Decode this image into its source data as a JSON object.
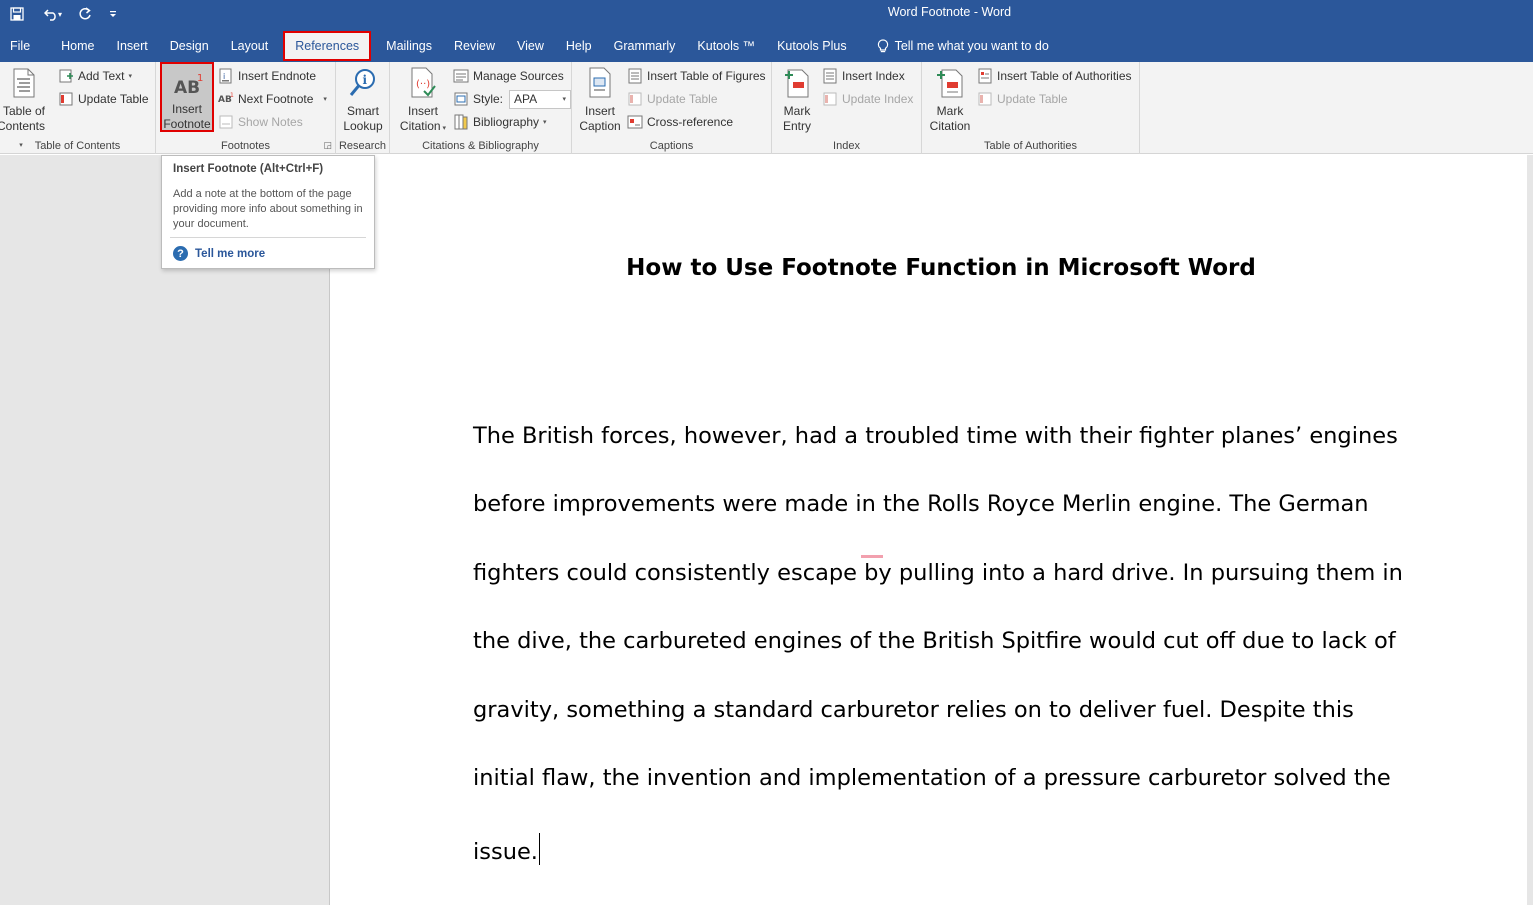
{
  "window": {
    "title": "Word Footnote  -  Word"
  },
  "qat": {
    "save_icon": "save-icon",
    "undo_icon": "undo-icon",
    "redo_icon": "redo-icon",
    "customize_icon": "customize-icon"
  },
  "tabs": [
    {
      "label": "File"
    },
    {
      "label": "Home"
    },
    {
      "label": "Insert"
    },
    {
      "label": "Design"
    },
    {
      "label": "Layout"
    },
    {
      "label": "References",
      "active": true
    },
    {
      "label": "Mailings"
    },
    {
      "label": "Review"
    },
    {
      "label": "View"
    },
    {
      "label": "Help"
    },
    {
      "label": "Grammarly"
    },
    {
      "label": "Kutools ™"
    },
    {
      "label": "Kutools Plus"
    }
  ],
  "tell_me": "Tell me what you want to do",
  "ribbon": {
    "toc": {
      "label": "Table of Contents",
      "big_line1": "Table of",
      "big_line2": "Contents",
      "add_text": "Add Text",
      "update_table": "Update Table"
    },
    "footnotes": {
      "label": "Footnotes",
      "insert_line1": "Insert",
      "insert_line2": "Footnote",
      "insert_endnote": "Insert Endnote",
      "next_footnote": "Next Footnote",
      "show_notes": "Show Notes"
    },
    "research": {
      "label": "Research",
      "line1": "Smart",
      "line2": "Lookup"
    },
    "citations": {
      "label": "Citations & Bibliography",
      "insert_line1": "Insert",
      "insert_line2": "Citation",
      "manage_sources": "Manage Sources",
      "style_label": "Style:",
      "style_value": "APA",
      "bibliography": "Bibliography"
    },
    "captions": {
      "label": "Captions",
      "insert_line1": "Insert",
      "insert_line2": "Caption",
      "insert_table_figures": "Insert Table of Figures",
      "update_table": "Update Table",
      "cross_reference": "Cross-reference"
    },
    "index": {
      "label": "Index",
      "mark_line1": "Mark",
      "mark_line2": "Entry",
      "insert_index": "Insert Index",
      "update_index": "Update Index"
    },
    "authorities": {
      "label": "Table of Authorities",
      "mark_line1": "Mark",
      "mark_line2": "Citation",
      "insert_table": "Insert Table of Authorities",
      "update_table": "Update Table"
    }
  },
  "tooltip": {
    "title": "Insert Footnote (Alt+Ctrl+F)",
    "description": "Add a note at the bottom of the page providing more info about something in your document.",
    "link": "Tell me more"
  },
  "document": {
    "title": "How to Use Footnote Function in Microsoft Word",
    "lines": [
      "The British forces, however, had a troubled time with their fighter planes’ engines",
      "before improvements were made in the Rolls Royce Merlin engine. The German",
      "fighters could consistently escape by pulling into a hard drive. In pursuing them in",
      "the dive, the carbureted engines of the British Spitfire would cut off due to lack of",
      "gravity, something a standard carburetor relies on to deliver fuel. Despite this",
      "initial flaw, the invention and implementation of a pressure carburetor solved the",
      "issue."
    ]
  },
  "colors": {
    "accent": "#2b579a",
    "highlight_border": "#e00000"
  }
}
